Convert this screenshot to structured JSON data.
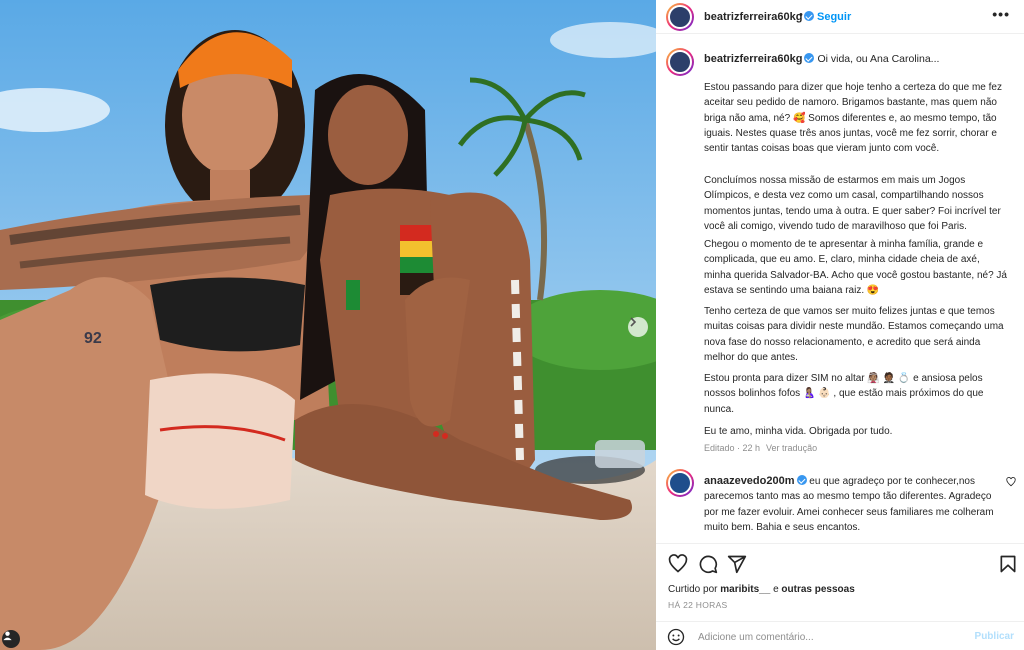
{
  "post": {
    "username": "beatrizferreira60kg",
    "follow_label": "Seguir",
    "more_label": "•••"
  },
  "caption": {
    "username": "beatrizferreira60kg",
    "intro": "Oi vida, ou Ana Carolina...",
    "paragraphs": [
      "Estou passando para dizer que hoje tenho a certeza do que me fez aceitar seu pedido de namoro. Brigamos bastante, mas quem não briga não ama, né? 🥰 Somos diferentes e, ao mesmo tempo, tão iguais. Nestes quase três anos juntas, você me fez sorrir, chorar e sentir tantas coisas boas que vieram junto com você.",
      "Concluímos nossa missão de estarmos em mais um Jogos Olímpicos, e desta vez como um casal, compartilhando nossos momentos juntas, tendo uma à outra. E quer saber? Foi incrível ter você ali comigo, vivendo tudo de maravilhoso que foi Paris.",
      "Chegou o momento de te apresentar à minha família, grande e complicada, que eu amo. E, claro, minha cidade cheia de axé, minha querida Salvador-BA. Acho que você gostou bastante, né? Já estava se sentindo uma baiana raiz. 😍",
      "Tenho certeza de que vamos ser muito felizes juntas e que temos muitas coisas para dividir neste mundão. Estamos começando uma nova fase do nosso relacionamento, e acredito que será ainda melhor do que antes.",
      "Estou pronta para dizer SIM no altar 👰🏽 🤵🏾 💍 e ansiosa pelos nossos bolinhos fofos 🤱🏽 👶🏻 , que estão mais próximos do que nunca.",
      "Eu te amo, minha vida. Obrigada por tudo."
    ],
    "edited": "Editado · 22 h",
    "translate": "Ver tradução"
  },
  "comment": {
    "username": "anaazevedo200m",
    "text": "eu que agradeço por te conhecer,nos parecemos tanto mas ao mesmo tempo tão diferentes. Agradeço por me fazer evoluir. Amei conhecer seus familiares me colheram muito bem. Bahia e seus encantos."
  },
  "likes": {
    "prefix": "Curtido por",
    "user": "maribits__",
    "conj": "e",
    "others": "outras pessoas"
  },
  "time_ago": "HÁ 22 HORAS",
  "comment_input": {
    "placeholder": "Adicione um comentário..."
  },
  "publish_label": "Publicar",
  "photo": {
    "tattoo_text": "92",
    "accent_colors": [
      "#f07a1a",
      "#1d8b34",
      "#f2c12e",
      "#d32a1f"
    ]
  },
  "icons": [
    "heart-icon",
    "comment-icon",
    "share-icon",
    "bookmark-icon",
    "emoji-icon",
    "chevron-right-icon",
    "tag-user-icon",
    "verified-badge-icon"
  ]
}
